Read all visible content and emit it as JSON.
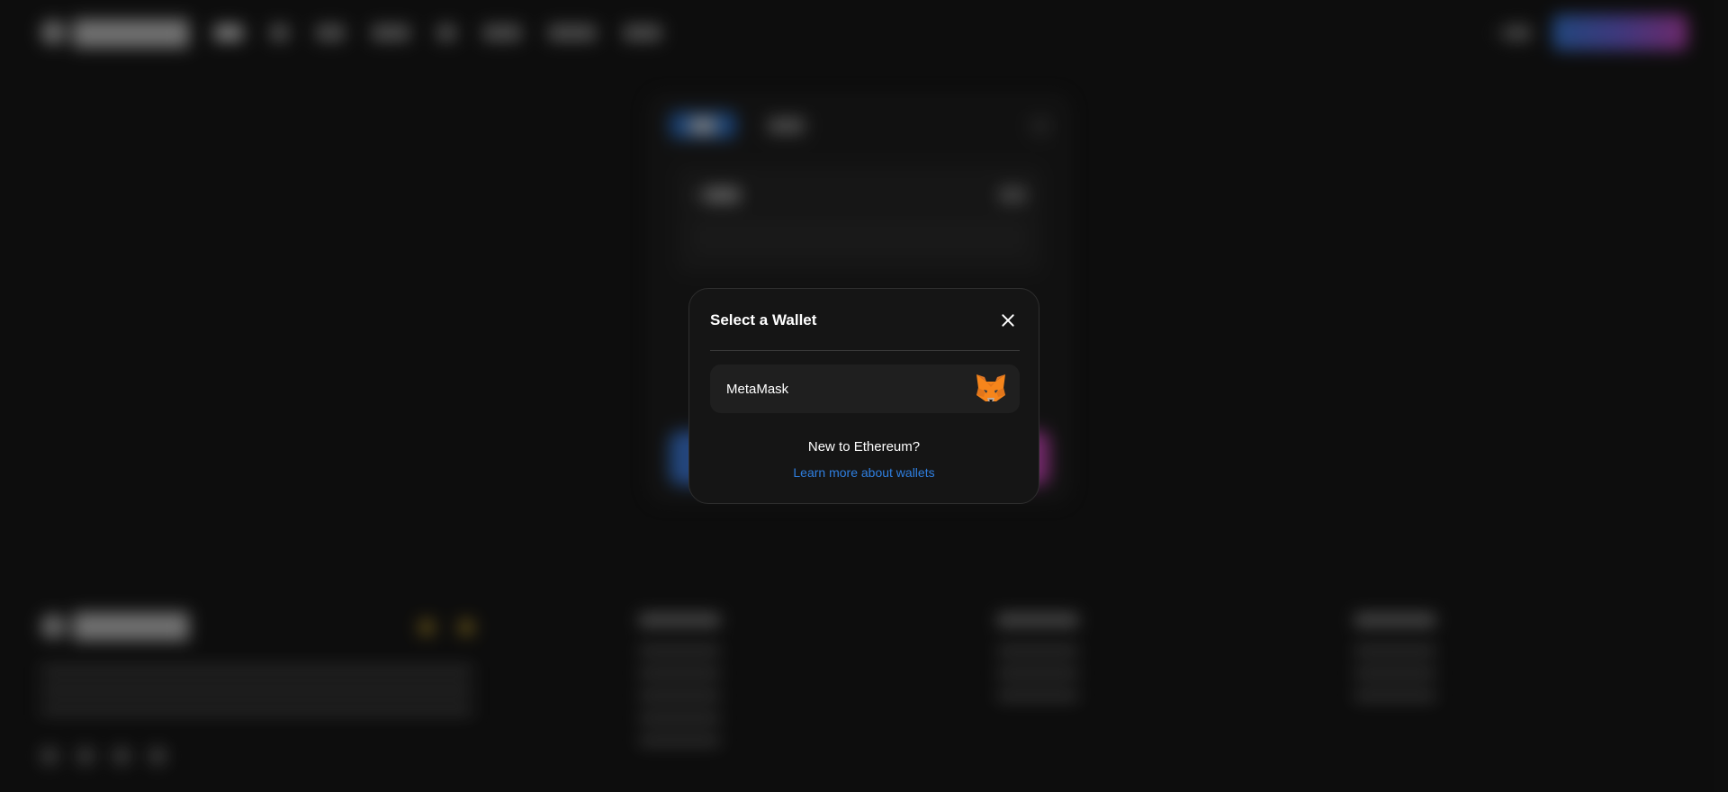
{
  "modal": {
    "title": "Select a Wallet",
    "wallets": [
      {
        "name": "MetaMask",
        "icon": "metamask-fox-icon"
      }
    ],
    "new_prompt": "New to Ethereum?",
    "learn_link": "Learn more about wallets"
  },
  "colors": {
    "accent_blue": "#2f7fe0",
    "modal_bg": "#151515",
    "page_bg": "#101010"
  }
}
